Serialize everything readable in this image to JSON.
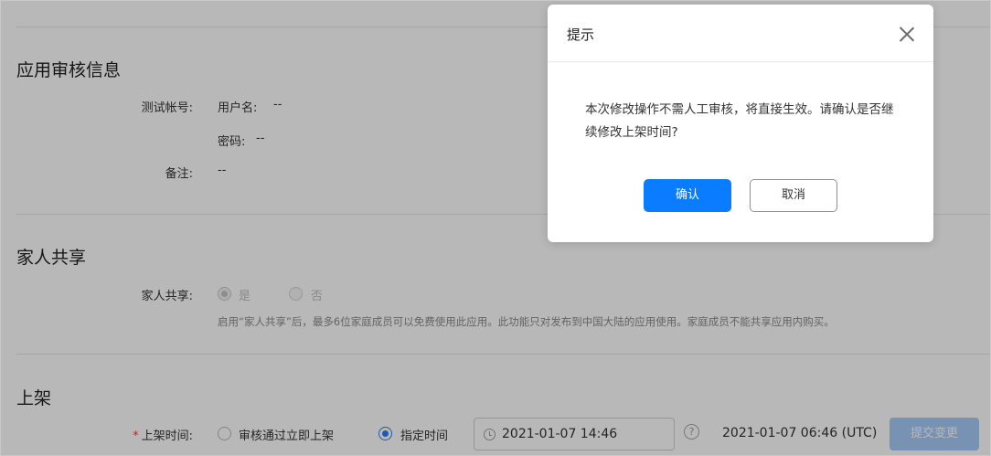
{
  "review_section": {
    "title": "应用审核信息",
    "test_account_label": "测试帐号:",
    "username_label": "用户名:",
    "username_value": "--",
    "password_label": "密码:",
    "password_value": "--",
    "remarks_label": "备注:",
    "remarks_value": "--"
  },
  "family_section": {
    "title": "家人共享",
    "sharing_label": "家人共享:",
    "option_yes": "是",
    "option_no": "否",
    "selected": "是",
    "hint": "启用“家人共享”后，最多6位家庭成员可以免费使用此应用。此功能只对发布到中国大陆的应用使用。家庭成员不能共享应用内购买。"
  },
  "listing_section": {
    "title": "上架",
    "required_mark": "*",
    "time_label": "上架时间:",
    "option_immediate": "审核通过立即上架",
    "option_scheduled": "指定时间",
    "selected": "指定时间",
    "datetime_value": "2021-01-07 14:46",
    "help_glyph": "?",
    "utc_text": "2021-01-07 06:46 (UTC)",
    "submit_label": "提交变更",
    "submit_enabled": false
  },
  "dialog": {
    "title": "提示",
    "message": "本次修改操作不需人工审核，将直接生效。请确认是否继续修改上架时间?",
    "confirm_label": "确认",
    "cancel_label": "取消"
  },
  "icons": {
    "close": "close-icon",
    "clock": "clock-icon",
    "help": "help-icon"
  },
  "colors": {
    "primary": "#0a7cff",
    "radio_active": "#2a7ef4",
    "submit_disabled": "#a7cbfa",
    "required": "#e8453c",
    "mask": "rgba(0,0,0,0.28)"
  }
}
